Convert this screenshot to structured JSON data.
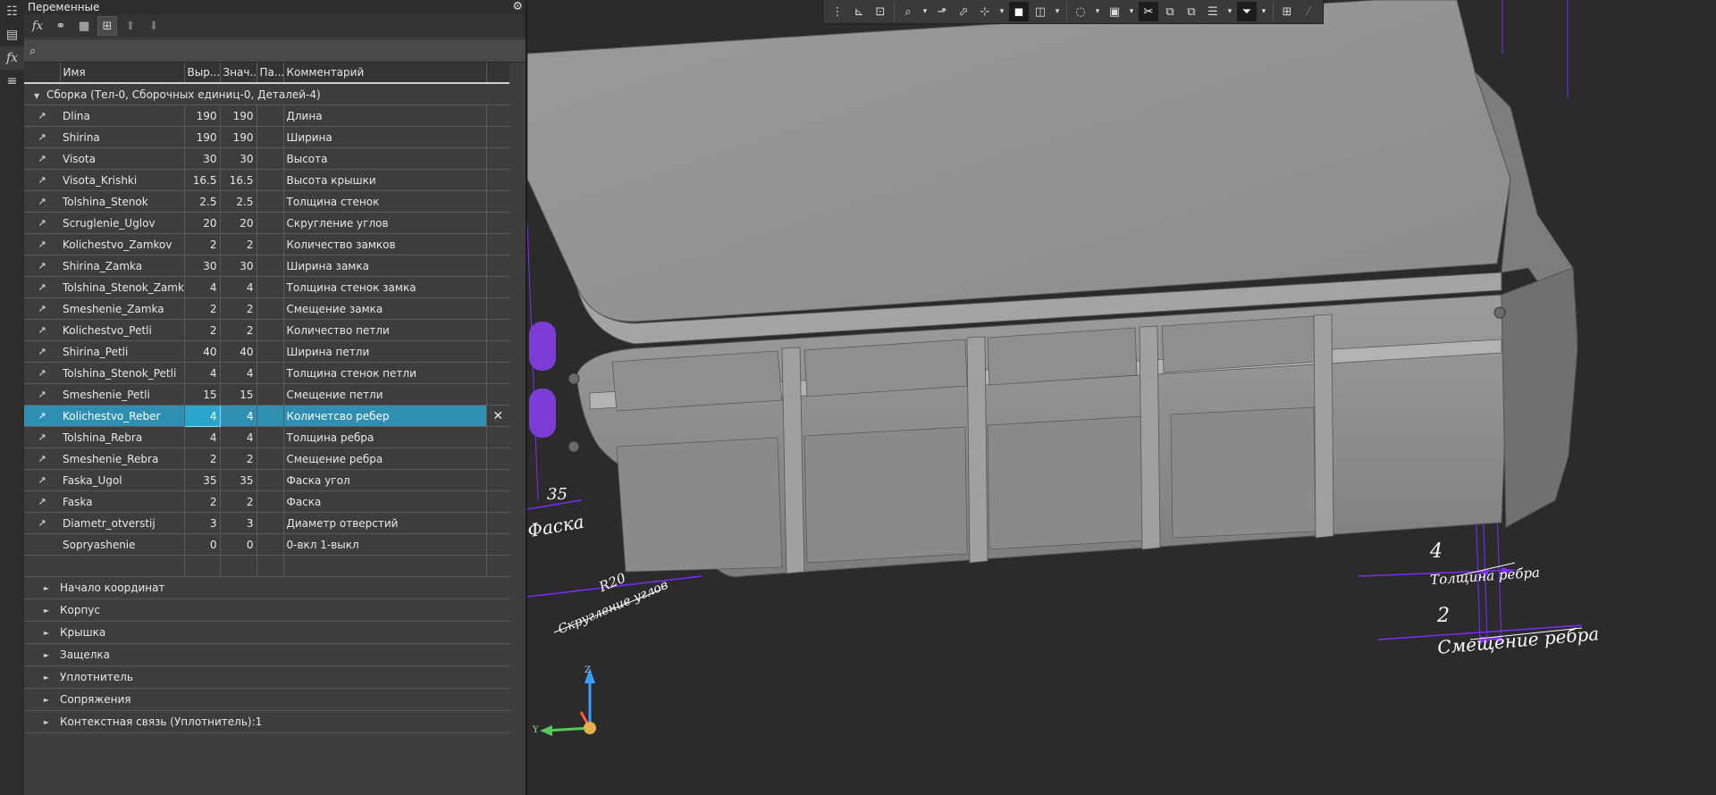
{
  "panel": {
    "title": "Переменные",
    "toolbar_icons": [
      "fx-icon",
      "link-icon",
      "table-icon",
      "tree-icon",
      "arrow-up-icon",
      "arrow-down-icon"
    ],
    "columns": [
      "Имя",
      "Выр...",
      "Знач...",
      "Па...",
      "Комментарий"
    ],
    "group_label": "Сборка (Тел-0, Сборочных единиц-0, Деталей-4)",
    "rows": [
      {
        "arrow": "↗",
        "name": "Dlina",
        "expr": "190",
        "value": "190",
        "comment": "Длина"
      },
      {
        "arrow": "↗",
        "name": "Shirina",
        "expr": "190",
        "value": "190",
        "comment": "Ширина"
      },
      {
        "arrow": "↗",
        "name": "Visota",
        "expr": "30",
        "value": "30",
        "comment": "Высота"
      },
      {
        "arrow": "↗",
        "name": "Visota_Krishki",
        "expr": "16.5",
        "value": "16.5",
        "comment": "Высота крышки"
      },
      {
        "arrow": "↗",
        "name": "Tolshina_Stenok",
        "expr": "2.5",
        "value": "2.5",
        "comment": "Толщина стенок"
      },
      {
        "arrow": "↗",
        "name": "Scruglenie_Uglov",
        "expr": "20",
        "value": "20",
        "comment": "Скругление углов"
      },
      {
        "arrow": "↗",
        "name": "Kolichestvo_Zamkov",
        "expr": "2",
        "value": "2",
        "comment": "Количество замков"
      },
      {
        "arrow": "↗",
        "name": "Shirina_Zamka",
        "expr": "30",
        "value": "30",
        "comment": "Ширина замка"
      },
      {
        "arrow": "↗",
        "name": "Tolshina_Stenok_Zamka",
        "expr": "4",
        "value": "4",
        "comment": "Толщина стенок замка"
      },
      {
        "arrow": "↗",
        "name": "Smeshenie_Zamka",
        "expr": "2",
        "value": "2",
        "comment": "Смещение замка"
      },
      {
        "arrow": "↗",
        "name": "Kolichestvo_Petli",
        "expr": "2",
        "value": "2",
        "comment": "Количество петли"
      },
      {
        "arrow": "↗",
        "name": "Shirina_Petli",
        "expr": "40",
        "value": "40",
        "comment": "Ширина петли"
      },
      {
        "arrow": "↗",
        "name": "Tolshina_Stenok_Petli",
        "expr": "4",
        "value": "4",
        "comment": "Толщина стенок петли"
      },
      {
        "arrow": "↗",
        "name": "Smeshenie_Petli",
        "expr": "15",
        "value": "15",
        "comment": "Смещение петли"
      },
      {
        "arrow": "↗",
        "name": "Kolichestvo_Reber",
        "expr": "4",
        "value": "4",
        "comment": "Количетсво ребер",
        "selected": true
      },
      {
        "arrow": "↗",
        "name": "Tolshina_Rebra",
        "expr": "4",
        "value": "4",
        "comment": "Толщина ребра"
      },
      {
        "arrow": "↗",
        "name": "Smeshenie_Rebra",
        "expr": "2",
        "value": "2",
        "comment": "Смещение ребра"
      },
      {
        "arrow": "↗",
        "name": "Faska_Ugol",
        "expr": "35",
        "value": "35",
        "comment": "Фаска угол"
      },
      {
        "arrow": "↗",
        "name": "Faska",
        "expr": "2",
        "value": "2",
        "comment": "Фаска"
      },
      {
        "arrow": "↗",
        "name": "Diametr_otverstij",
        "expr": "3",
        "value": "3",
        "comment": "Диаметр отверстий"
      },
      {
        "arrow": "",
        "name": "Sopryashenie",
        "expr": "0",
        "value": "0",
        "comment": "0-вкл 1-выкл"
      }
    ],
    "close_glyph": "✕",
    "sections": [
      "Начало координат",
      "Корпус",
      "Крышка",
      "Защелка",
      "Уплотнитель",
      "Сопряжения",
      "Контекстная связь (Уплотнитель):1"
    ]
  },
  "viewport": {
    "dimensions": {
      "rib_thickness_value": "4",
      "rib_thickness_label": "Толщина ребра",
      "rib_offset_value": "2",
      "rib_offset_label": "Смещение ребра",
      "fillet_value": "R20",
      "fillet_label": "Скругление углов",
      "chamfer_label": "Фаска",
      "chamfer_value": "35"
    },
    "axis_labels": {
      "z": "Z",
      "y": "Y"
    },
    "toolbar_icons": [
      "grid-icon",
      "sketch-icon",
      "drawing-icon",
      "zoom-icon",
      "view-icon",
      "orient-icon",
      "axes-icon",
      "shaded-cube-icon",
      "wire-cube-icon",
      "hide-icon",
      "render-icon",
      "section-icon",
      "layers-icon",
      "filter-icon",
      "measure-icon",
      "pipette-icon"
    ]
  },
  "colors": {
    "accent_selection": "#2f8fb3",
    "dimension_line": "#7b2cff",
    "model_gray": "#8a8a8a",
    "panel_bg": "#3d3d3d"
  }
}
